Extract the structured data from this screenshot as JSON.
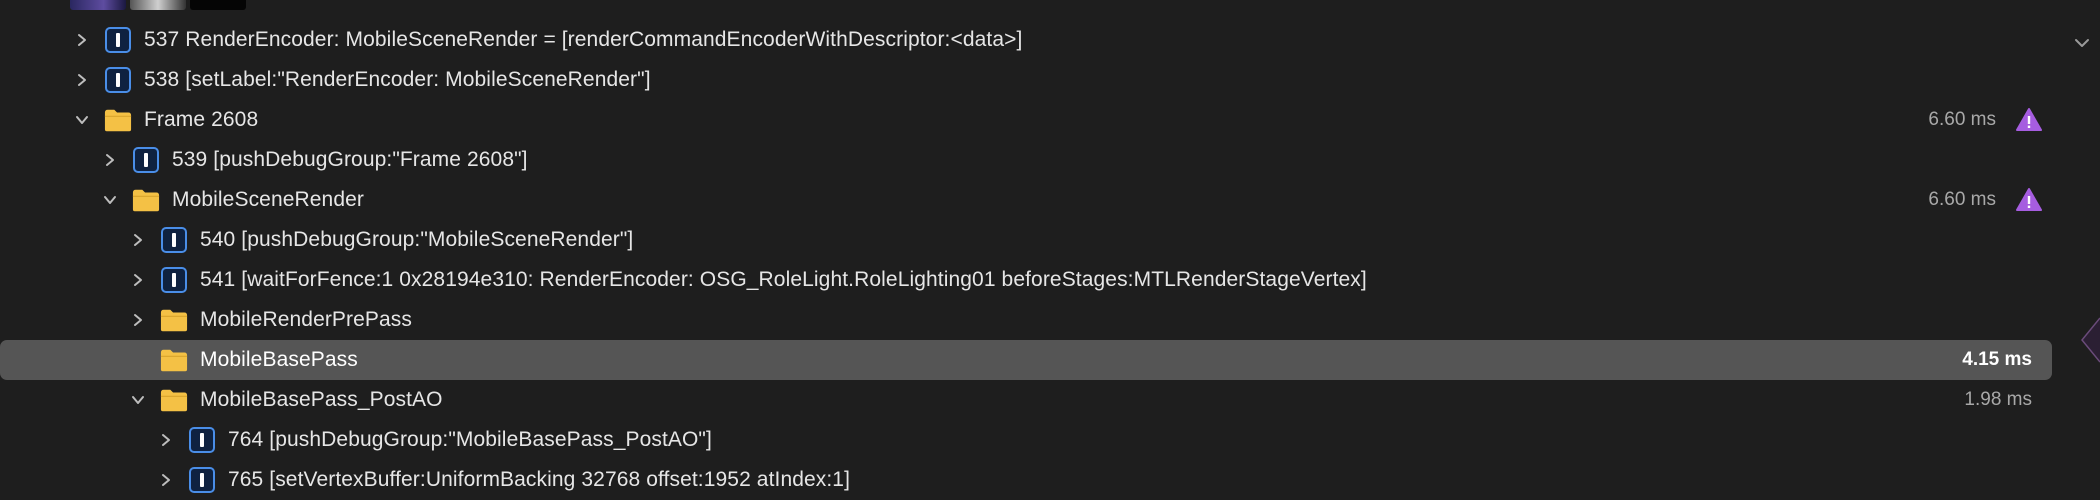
{
  "rows": [
    {
      "id": "537",
      "kind": "command",
      "label": "537 RenderEncoder: MobileSceneRender = [renderCommandEncoderWithDescriptor:<data>]",
      "duration": "",
      "expanded": false,
      "level": 0
    },
    {
      "id": "538",
      "kind": "command",
      "label": "538 [setLabel:\"RenderEncoder: MobileSceneRender\"]",
      "duration": "",
      "expanded": false,
      "level": 0
    },
    {
      "id": "frame",
      "kind": "group",
      "label": "Frame 2608",
      "duration": "6.60 ms",
      "warning": true,
      "expanded": true,
      "level": 0
    },
    {
      "id": "539",
      "kind": "command",
      "label": "539 [pushDebugGroup:\"Frame 2608\"]",
      "duration": "",
      "expanded": false,
      "level": 1
    },
    {
      "id": "msr",
      "kind": "group",
      "label": "MobileSceneRender",
      "duration": "6.60 ms",
      "warning": true,
      "expanded": true,
      "level": 1
    },
    {
      "id": "540",
      "kind": "command",
      "label": "540 [pushDebugGroup:\"MobileSceneRender\"]",
      "duration": "",
      "expanded": false,
      "level": 2
    },
    {
      "id": "541",
      "kind": "command",
      "label": "541 [waitForFence:1 0x28194e310: RenderEncoder: OSG_RoleLight.RoleLighting01 beforeStages:MTLRenderStageVertex]",
      "duration": "",
      "expanded": false,
      "level": 2
    },
    {
      "id": "mrp",
      "kind": "group",
      "label": "MobileRenderPrePass",
      "duration": "",
      "expanded": false,
      "level": 2
    },
    {
      "id": "mbp",
      "kind": "group",
      "label": "MobileBasePass",
      "duration": "4.15 ms",
      "selected": true,
      "level": 2,
      "no_chevron": true
    },
    {
      "id": "mbpao",
      "kind": "group",
      "label": "MobileBasePass_PostAO",
      "duration": "1.98 ms",
      "expanded": true,
      "level": 2
    },
    {
      "id": "764",
      "kind": "command",
      "label": "764 [pushDebugGroup:\"MobileBasePass_PostAO\"]",
      "duration": "",
      "expanded": false,
      "level": 3
    },
    {
      "id": "765",
      "kind": "command",
      "label": "765 [setVertexBuffer:UniformBacking 32768 offset:1952 atIndex:1]",
      "duration": "",
      "expanded": false,
      "level": 3
    }
  ],
  "colors": {
    "accent": "#4a8ee8",
    "folder": "#f4c145",
    "warning": "#a65de0",
    "selection": "#555555"
  },
  "icons": {
    "command": "command-icon",
    "group": "folder-icon",
    "warning": "warning-icon"
  }
}
